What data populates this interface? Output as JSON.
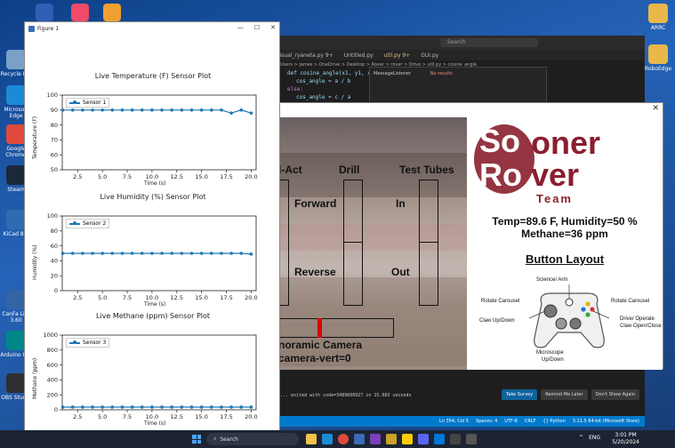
{
  "desktop": {
    "icons_left": [
      {
        "label": "Recycle Bin",
        "color": "#7aa0c8"
      },
      {
        "label": "Microsoft Edge",
        "color": "#1c8bd6"
      },
      {
        "label": "Google Chrome",
        "color": "#e04a3c"
      },
      {
        "label": "Steam",
        "color": "#1b2838"
      },
      {
        "label": "KiCad 8.0",
        "color": "#2d6cb0"
      },
      {
        "label": "CanFa Lite 3.60",
        "color": "#3463a6"
      },
      {
        "label": "Arduino IDE",
        "color": "#00878a"
      },
      {
        "label": "OBS Studio",
        "color": "#302e31"
      }
    ],
    "icons_right": [
      {
        "label": "ARRC",
        "color": "#e8b84a"
      },
      {
        "label": "RoboEdge",
        "color": "#e8b84a"
      }
    ]
  },
  "vscode": {
    "search_placeholder": "Search",
    "tabs": [
      "visual_ryaneta.py 9+",
      "Untitled.py",
      "util.py 9+",
      "GUI.py",
      "cosine_angle"
    ],
    "breadcrumb": "Users > james > OneDrive > Desktop > Rover > rover > Drive > util.py > cosine_angle",
    "code_lines": [
      "def cosine_angle(x1, y1, x2, y2, x3, y3):",
      "    cos_angle = a / b",
      "else:",
      "    cos_angle = c / a"
    ],
    "panel_title": "MessageListener",
    "panel_result": "No results",
    "terminal_line": "... exited with code=3489660927 in 15.083 seconds",
    "notification_buttons": [
      "Take Survey",
      "Remind Me Later",
      "Don't Show Again"
    ],
    "status_items": [
      "Ln 354, Col 5",
      "Spaces: 4",
      "UTF-8",
      "CRLF",
      "{} Python",
      "3.11.5 64-bit (Microsoft Store)"
    ]
  },
  "rover_gui": {
    "camera_labels": {
      "arm_act": "l-Act",
      "drill": "Drill",
      "test_tubes": "Test Tubes",
      "forward": "Forward",
      "in": "In",
      "reverse": "Reverse",
      "out": "Out",
      "panoramic": "noramic Camera",
      "camera_vert": "camera-vert=0"
    },
    "logo": {
      "line1_big": "So",
      "line1_rest": "oner",
      "line2_big": "Ro",
      "line2_rest": "ver",
      "team": "Team"
    },
    "readouts": {
      "temp_humidity": "Temp=89.6 F, Humidity=50 %",
      "methane": "Methane=36 ppm"
    },
    "button_layout": {
      "title": "Button Layout",
      "labels": {
        "science_arm": "Science/ Arm",
        "rotate_left": "Rotate Carousel",
        "rotate_right": "Rotate Carousel",
        "claw_updown": "Claw Up/Down",
        "drive_operate": "Drive/ Operate",
        "claw_openclose": "Claw Open/Close",
        "microscope": "Microscope",
        "microscope_sub": "Up/Down"
      }
    }
  },
  "figure": {
    "window_title": "Figure 1",
    "plots": [
      {
        "title": "Live Temperature (F) Sensor  Plot",
        "ylabel": "Temperature (F)",
        "xlabel": "Time (s)",
        "legend": "Sensor 1"
      },
      {
        "title": "Live Humidity (%) Sensor  Plot",
        "ylabel": "Humidity (%)",
        "xlabel": "Time (s)",
        "legend": "Sensor 2"
      },
      {
        "title": "Live Methane (ppm) Sensor  Plot",
        "ylabel": "Methane (ppm)",
        "xlabel": "Time (s)",
        "legend": "Sensor 3"
      }
    ]
  },
  "chart_data": [
    {
      "type": "line",
      "title": "Live Temperature (F) Sensor  Plot",
      "xlabel": "Time (s)",
      "ylabel": "Temperature (F)",
      "x": [
        1,
        2,
        3,
        4,
        5,
        6,
        7,
        8,
        9,
        10,
        11,
        12,
        13,
        14,
        15,
        16,
        17,
        18,
        19,
        20
      ],
      "series": [
        {
          "name": "Sensor 1",
          "values": [
            90,
            90,
            90,
            90,
            90,
            90,
            90,
            90,
            90,
            90,
            90,
            90,
            90,
            90,
            90,
            90,
            90,
            88,
            90,
            88
          ]
        }
      ],
      "xticks": [
        "2.5",
        "5.0",
        "7.5",
        "10.0",
        "12.5",
        "15.0",
        "17.5",
        "20.0"
      ],
      "yticks": [
        "50",
        "60",
        "70",
        "80",
        "90",
        "100"
      ],
      "xlim": [
        0.95,
        20.5
      ],
      "ylim": [
        50,
        100
      ]
    },
    {
      "type": "line",
      "title": "Live Humidity (%) Sensor  Plot",
      "xlabel": "Time (s)",
      "ylabel": "Humidity (%)",
      "x": [
        1,
        2,
        3,
        4,
        5,
        6,
        7,
        8,
        9,
        10,
        11,
        12,
        13,
        14,
        15,
        16,
        17,
        18,
        19,
        20
      ],
      "series": [
        {
          "name": "Sensor 2",
          "values": [
            50,
            50,
            50,
            50,
            50,
            50,
            50,
            50,
            50,
            50,
            50,
            50,
            50,
            50,
            50,
            50,
            50,
            50,
            50,
            49
          ]
        }
      ],
      "xticks": [
        "2.5",
        "5.0",
        "7.5",
        "10.0",
        "12.5",
        "15.0",
        "17.5",
        "20.0"
      ],
      "yticks": [
        "0",
        "20",
        "40",
        "60",
        "80",
        "100"
      ],
      "xlim": [
        0.95,
        20.5
      ],
      "ylim": [
        0,
        100
      ]
    },
    {
      "type": "line",
      "title": "Live Methane (ppm) Sensor  Plot",
      "xlabel": "Time (s)",
      "ylabel": "Methane (ppm)",
      "x": [
        1,
        2,
        3,
        4,
        5,
        6,
        7,
        8,
        9,
        10,
        11,
        12,
        13,
        14,
        15,
        16,
        17,
        18,
        19,
        20
      ],
      "series": [
        {
          "name": "Sensor 3",
          "values": [
            36,
            36,
            36,
            36,
            36,
            36,
            36,
            36,
            36,
            36,
            36,
            36,
            36,
            36,
            36,
            36,
            36,
            36,
            36,
            36
          ]
        }
      ],
      "xticks": [
        "2.5",
        "5.0",
        "7.5",
        "10.0",
        "12.5",
        "15.0",
        "17.5",
        "20.0"
      ],
      "yticks": [
        "0",
        "200",
        "400",
        "600",
        "800",
        "1000"
      ],
      "xlim": [
        0.95,
        20.5
      ],
      "ylim": [
        0,
        1000
      ]
    }
  ],
  "taskbar": {
    "search_placeholder": "Search",
    "time": "3:01 PM",
    "date": "5/20/2024",
    "tray": [
      "^",
      "ENG"
    ],
    "accent": "#1c2433"
  }
}
